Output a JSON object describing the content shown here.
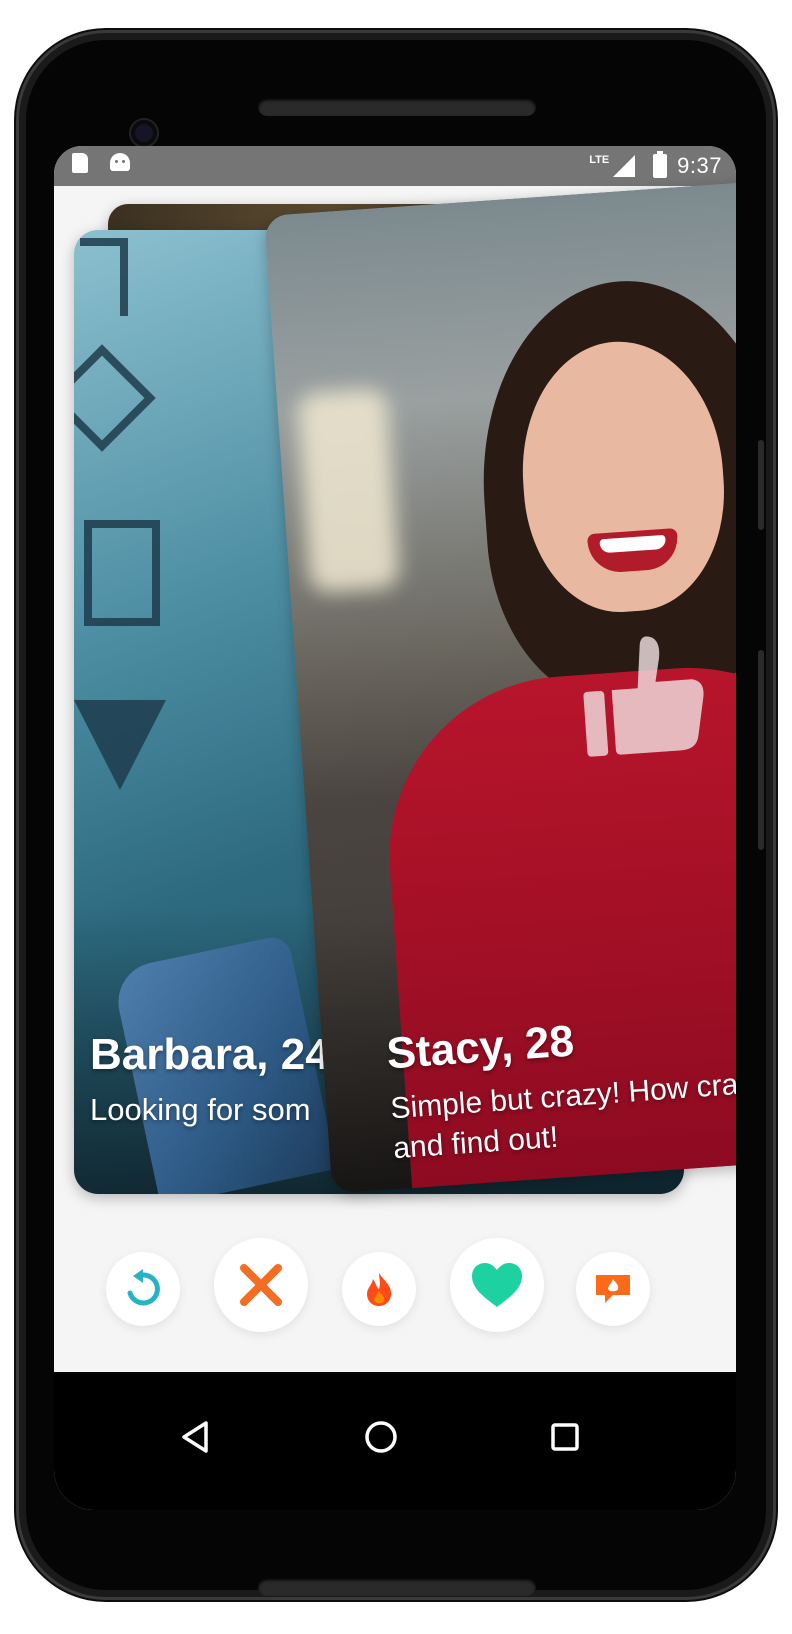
{
  "statusbar": {
    "network_label": "LTE",
    "time": "9:37",
    "icons": [
      "sd-card-icon",
      "android-debug-icon",
      "signal-icon",
      "battery-charging-icon"
    ]
  },
  "cards": {
    "back_card": {
      "name": ""
    },
    "barbara": {
      "name": "Barbara, 24",
      "bio": "Looking for som"
    },
    "stacy": {
      "name": "Stacy, 28",
      "bio": "Simple but crazy! How crazy? Come and find out!",
      "bio_line1": "Simple but crazy! How craz",
      "bio_line2": "and find out!",
      "overlay_icon": "thumbs-up-icon"
    }
  },
  "actions": [
    {
      "name": "rewind",
      "icon": "rewind-icon",
      "color": "#27b3c4"
    },
    {
      "name": "nope",
      "icon": "close-icon",
      "color": "#f46d22"
    },
    {
      "name": "super-like",
      "icon": "flame-icon",
      "color": "#ff5a1a"
    },
    {
      "name": "like",
      "icon": "heart-icon",
      "color": "#1ed1a1"
    },
    {
      "name": "boost",
      "icon": "boost-icon",
      "color": "#ff8a00"
    }
  ],
  "navbar": {
    "icons": [
      "back-icon",
      "home-icon",
      "recents-icon"
    ]
  },
  "colors": {
    "statusbar_bg": "#757575",
    "screen_bg": "#f5f5f5",
    "phone_body": "#1a1a1a"
  }
}
